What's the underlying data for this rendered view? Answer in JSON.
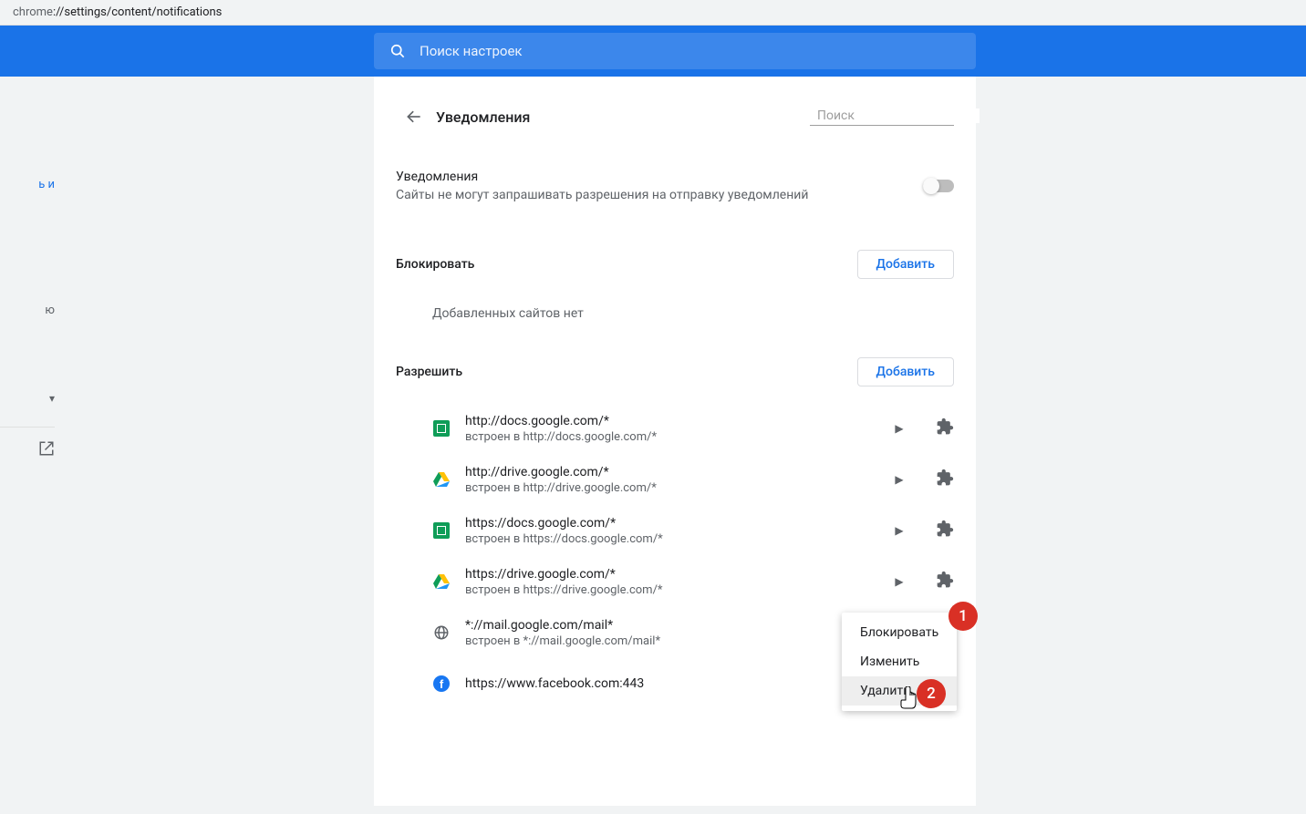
{
  "address": {
    "prefix": "chrome",
    "rest": "://settings/content/notifications"
  },
  "header_search_placeholder": "Поиск настроек",
  "sidebar": {
    "frag1": "ь и",
    "frag2": "ю"
  },
  "page_title": "Уведомления",
  "inline_search_placeholder": "Поиск",
  "main_toggle": {
    "title": "Уведомления",
    "subtitle": "Сайты не могут запрашивать разрешения на отправку уведомлений"
  },
  "block_section": {
    "title": "Блокировать",
    "add": "Добавить",
    "empty": "Добавленных сайтов нет"
  },
  "allow_section": {
    "title": "Разрешить",
    "add": "Добавить"
  },
  "allow_sites": [
    {
      "icon": "sheets",
      "url": "http://docs.google.com/*",
      "sub": "встроен в http://docs.google.com/*",
      "arrow": true,
      "ext": true
    },
    {
      "icon": "drive",
      "url": "http://drive.google.com/*",
      "sub": "встроен в http://drive.google.com/*",
      "arrow": true,
      "ext": true
    },
    {
      "icon": "sheets",
      "url": "https://docs.google.com/*",
      "sub": "встроен в https://docs.google.com/*",
      "arrow": true,
      "ext": true
    },
    {
      "icon": "drive",
      "url": "https://drive.google.com/*",
      "sub": "встроен в https://drive.google.com/*",
      "arrow": true,
      "ext": true
    },
    {
      "icon": "globe",
      "url": "*://mail.google.com/mail*",
      "sub": "встроен в *://mail.google.com/mail*",
      "arrow": false,
      "ext": true
    },
    {
      "icon": "fb",
      "url": "https://www.facebook.com:443",
      "sub": "",
      "arrow": false,
      "ext": false
    }
  ],
  "context_menu": {
    "block": "Блокировать",
    "edit": "Изменить",
    "delete": "Удалить"
  },
  "annotations": {
    "one": "1",
    "two": "2"
  }
}
